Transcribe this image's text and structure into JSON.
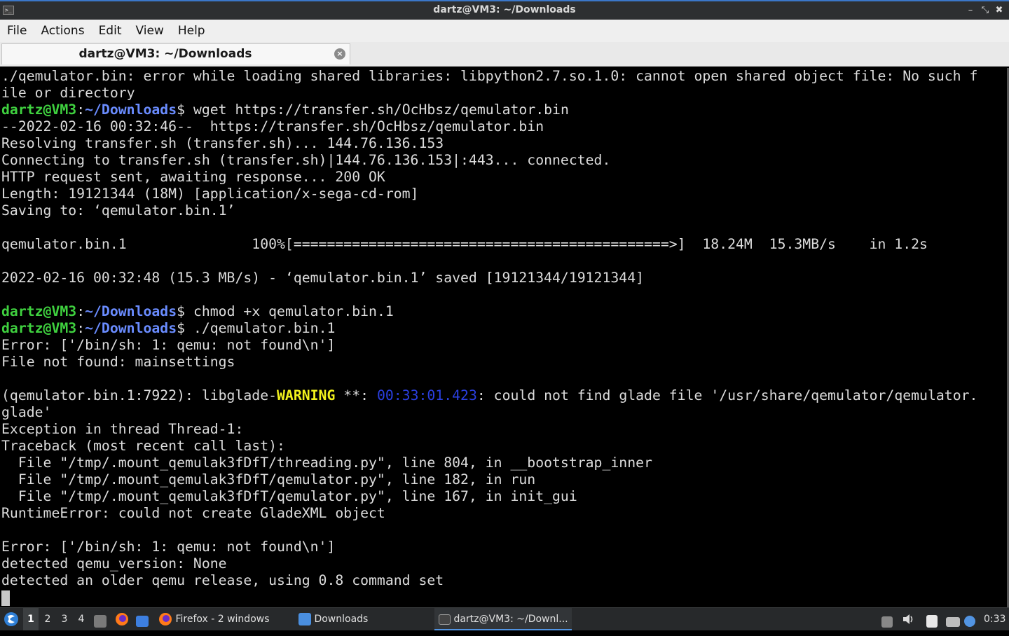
{
  "window": {
    "title": "dartz@VM3: ~/Downloads",
    "icon_label": ">_",
    "minimize": "–",
    "maximize": "⤡",
    "close": "✖"
  },
  "menu": [
    "File",
    "Actions",
    "Edit",
    "View",
    "Help"
  ],
  "tab": {
    "label": "dartz@VM3: ~/Downloads",
    "close_glyph": "×"
  },
  "prompt": {
    "user": "dartz@VM3",
    "sep": ":",
    "path": "~/Downloads",
    "sym": "$"
  },
  "terminal": {
    "l01": "./qemulator.bin: error while loading shared libraries: libpython2.7.so.1.0: cannot open shared object file: No such f",
    "l02": "ile or directory",
    "cmd1": " wget https://transfer.sh/OcHbsz/qemulator.bin",
    "l04": "--2022-02-16 00:32:46--  https://transfer.sh/OcHbsz/qemulator.bin",
    "l05": "Resolving transfer.sh (transfer.sh)... 144.76.136.153",
    "l06": "Connecting to transfer.sh (transfer.sh)|144.76.136.153|:443... connected.",
    "l07": "HTTP request sent, awaiting response... 200 OK",
    "l08": "Length: 19121344 (18M) [application/x-sega-cd-rom]",
    "l09": "Saving to: ‘qemulator.bin.1’",
    "l11": "qemulator.bin.1               100%[=============================================>]  18.24M  15.3MB/s    in 1.2s",
    "l13": "2022-02-16 00:32:48 (15.3 MB/s) - ‘qemulator.bin.1’ saved [19121344/19121344]",
    "cmd2": " chmod +x qemulator.bin.1",
    "cmd3": " ./qemulator.bin.1",
    "l17": "Error: ['/bin/sh: 1: qemu: not found\\n']",
    "l18": "File not found: mainsettings",
    "l20_a": "(qemulator.bin.1:7922): libglade-",
    "l20_warn": "WARNING",
    "l20_b": " **: ",
    "l20_ts": "00:33:01.423",
    "l20_c": ": could not find glade file '/usr/share/qemulator/qemulator.",
    "l21": "glade'",
    "l22": "Exception in thread Thread-1:",
    "l23": "Traceback (most recent call last):",
    "l24": "  File \"/tmp/.mount_qemulak3fDfT/threading.py\", line 804, in __bootstrap_inner",
    "l25": "  File \"/tmp/.mount_qemulak3fDfT/qemulator.py\", line 182, in run",
    "l26": "  File \"/tmp/.mount_qemulak3fDfT/qemulator.py\", line 167, in init_gui",
    "l27": "RuntimeError: could not create GladeXML object",
    "l29": "Error: ['/bin/sh: 1: qemu: not found\\n']",
    "l30": "detected qemu_version: None",
    "l31": "detected an older qemu release, using 0.8 command set"
  },
  "taskbar": {
    "workspaces": [
      "1",
      "2",
      "3",
      "4"
    ],
    "active_workspace": "1",
    "tasks": {
      "firefox": "Firefox - 2 windows",
      "downloads": "Downloads",
      "terminal": "dartz@VM3: ~/Downl..."
    },
    "clock": "0:33"
  },
  "colors": {
    "prompt_user": "#3fd13f",
    "prompt_path": "#6a8cff",
    "warning": "#f0f01c",
    "timestamp": "#2a3fe0",
    "accent": "#5294e2"
  }
}
